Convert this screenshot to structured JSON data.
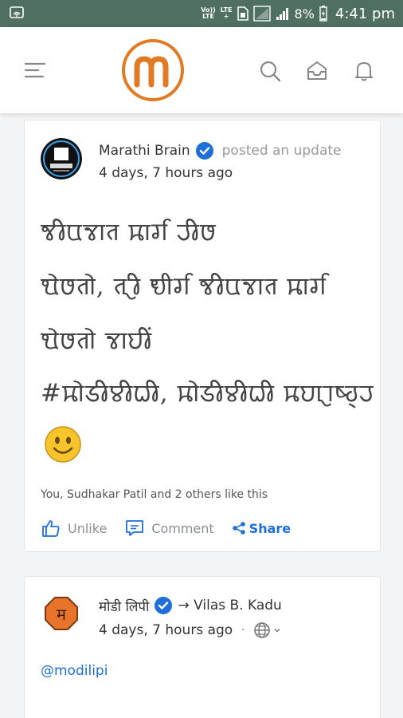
{
  "status_bar": {
    "volte_top": "Vo))",
    "volte_bottom": "LTE",
    "lte_top": "LTE",
    "lte_bottom": "+",
    "battery_percent": "8%",
    "time": "4:41 pm"
  },
  "header": {
    "icons": [
      "menu-icon",
      "logo",
      "search-icon",
      "inbox-icon",
      "bell-icon"
    ],
    "accent": "#e07b24"
  },
  "posts": [
    {
      "author": "Marathi Brain",
      "verified": true,
      "action": "posted an update",
      "time": "4 days, 7 hours ago",
      "body_lines": [
        "𑘕𑘲𑘪𑘡𑘰𑘝 𑘦𑘰𑘨𑘿𑘐 𑘨𑘲𑘭",
        "𑘌𑘭𑘝𑘻, 𑘝𑘨𑘲 𑘠𑘱𑘨𑘿𑘐 𑘕𑘲𑘪𑘡𑘰𑘝 𑘦𑘰𑘨𑘿𑘐",
        "𑘌𑘭𑘝𑘻 𑘡𑘰𑘮𑘲𑘽",
        "#𑘦𑘻𑘚𑘲𑘩𑘲𑘢𑘲, 𑘦𑘻𑘚𑘲𑘩𑘲𑘢𑘲 𑘦𑘮𑘰𑘨𑘰𑘬𑘿𑘘𑘿𑘨"
      ],
      "likes_text": "You, Sudhakar Patil and 2 others like this",
      "unlike_label": "Unlike",
      "comment_label": "Comment",
      "share_label": "Share"
    },
    {
      "author": "मोडी लिपी",
      "verified": true,
      "target": "→ Vilas B. Kadu",
      "time": "4 days, 7 hours ago",
      "visibility_sep": "·",
      "mention": "@modilipi"
    }
  ]
}
